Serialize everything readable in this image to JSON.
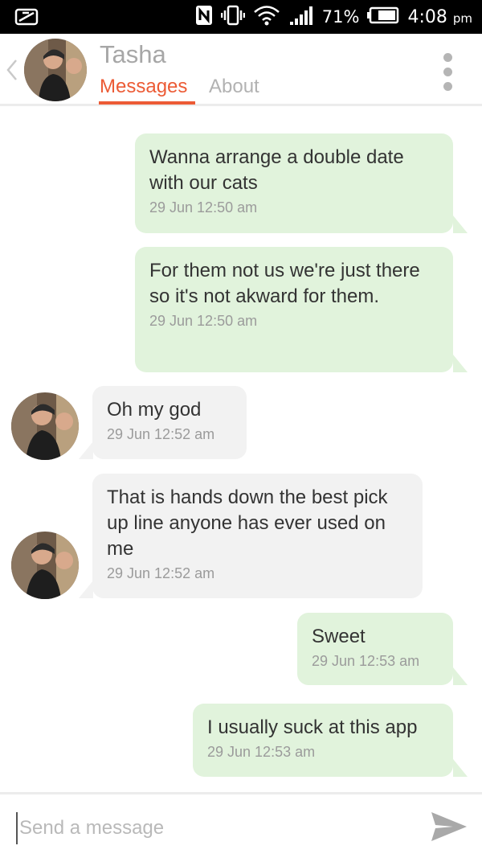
{
  "status_bar": {
    "battery_percent": "71%",
    "time": "4:08",
    "time_suffix": "pm",
    "icons": [
      "notification-icon",
      "nfc-icon",
      "vibrate-icon",
      "wifi-icon",
      "signal-icon",
      "battery-icon"
    ]
  },
  "header": {
    "contact_name": "Tasha",
    "tabs": [
      {
        "label": "Messages",
        "active": true
      },
      {
        "label": "About",
        "active": false
      }
    ],
    "accent_color": "#ec5b35"
  },
  "messages": [
    {
      "from": "me",
      "text": "Wanna arrange a double date with our cats",
      "time": "29 Jun 12:50 am"
    },
    {
      "from": "me",
      "text": "For them not us we're just there so it's not akward for them.",
      "time": "29 Jun 12:50 am"
    },
    {
      "from": "them",
      "text": "Oh my god",
      "time": "29 Jun 12:52 am"
    },
    {
      "from": "them",
      "text": "That is hands down the best pick up line anyone has ever used on me",
      "time": "29 Jun 12:52 am"
    },
    {
      "from": "me",
      "text": "Sweet",
      "time": "29 Jun 12:53 am"
    },
    {
      "from": "me",
      "text": "I usually suck at this app",
      "time": "29 Jun 12:53 am"
    }
  ],
  "composer": {
    "placeholder": "Send a message",
    "value": ""
  }
}
